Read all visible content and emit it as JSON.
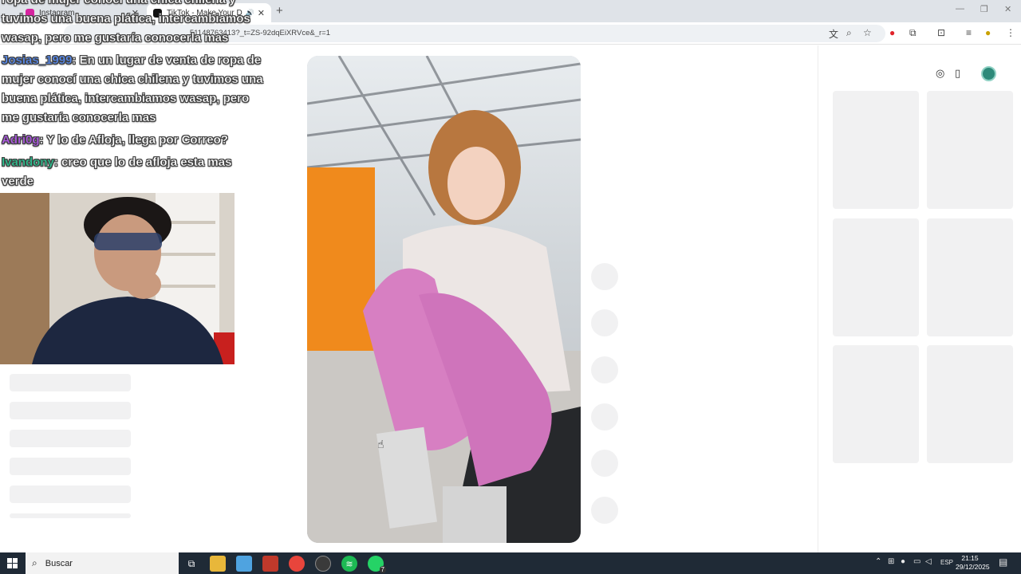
{
  "browser": {
    "tabs": [
      {
        "title": "Instagram",
        "favicon_color": "#d6249f"
      },
      {
        "title": "TikTok - Make Your Day",
        "favicon_color": "#111111"
      }
    ],
    "url": "...51148763413?_t=ZS-92dqEiXRVce&_r=1",
    "window_controls": [
      "—",
      "❐",
      "✕"
    ]
  },
  "chat": {
    "cut_lines": [
      "ropa de mujer conocí una chica chilena y",
      "tuvimos una buena plática, intercambiamos",
      "wasap, pero me gustaría conocerla mas"
    ],
    "messages": [
      {
        "user": "Josias_1999",
        "user_color": "#5b8def",
        "text": ": En un lugar de venta de ropa de mujer conocí una chica chilena y tuvimos una buena plática, intercambiamos wasap, pero me gustaría conocerla mas"
      },
      {
        "user": "Adri0g",
        "user_color": "#b15ce6",
        "text": ": Y lo de Afloja, llega por Correo?"
      },
      {
        "user": "Ivandony",
        "user_color": "#2fbf8f",
        "text": ": creo que lo de afloja esta mas verde"
      }
    ]
  },
  "icons": {
    "compass": "compass-icon",
    "phone": "phone-icon",
    "avatar": "user-avatar"
  },
  "taskbar": {
    "search_placeholder": "Buscar",
    "language": "ESP",
    "time": "21:15",
    "date": "29/12/2025",
    "whatsapp_badge": "7"
  }
}
